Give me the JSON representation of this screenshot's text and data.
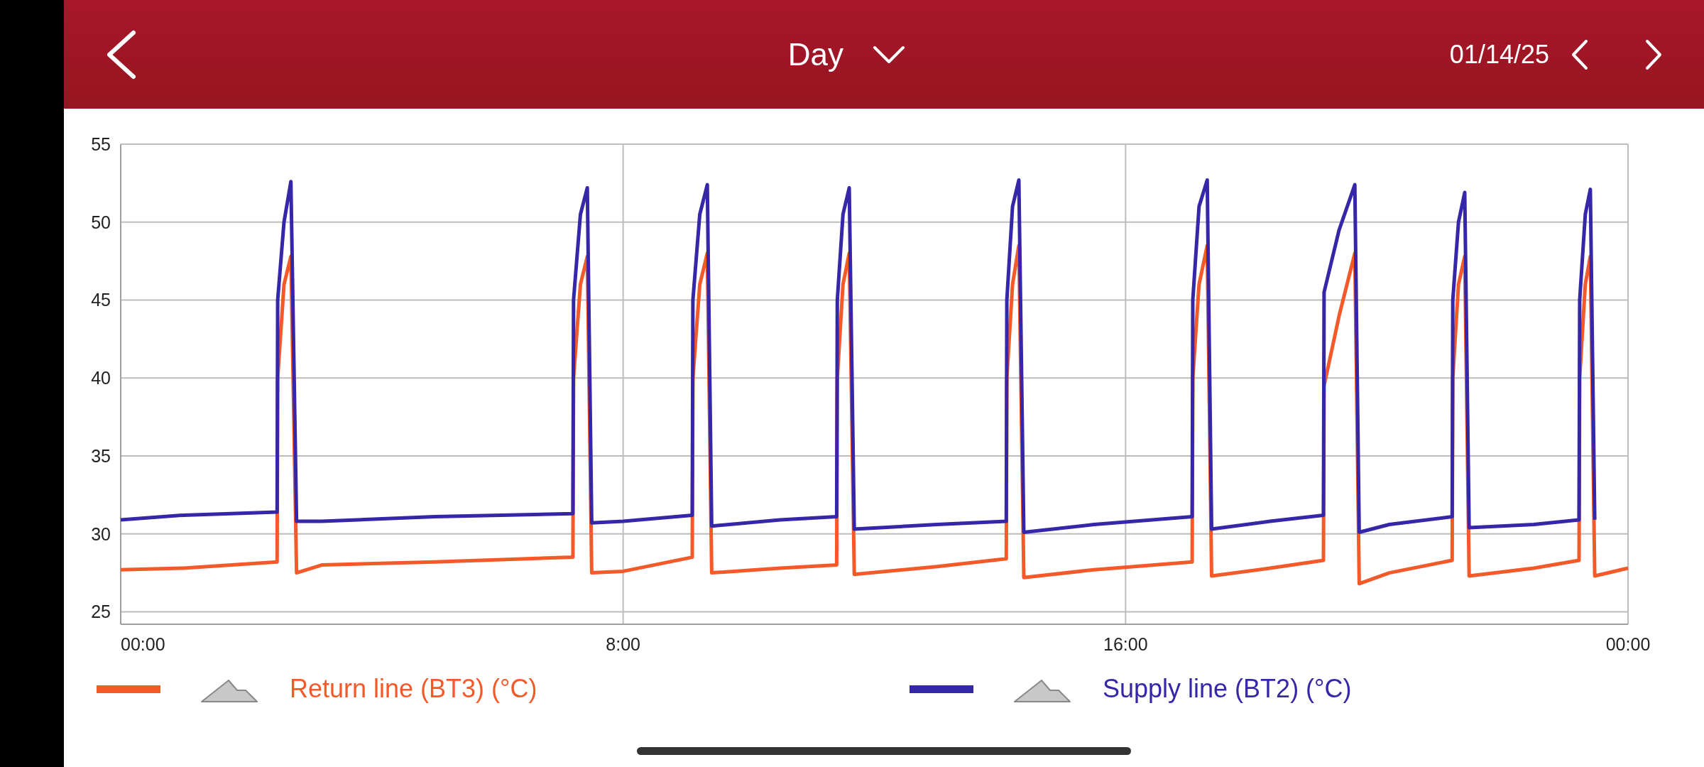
{
  "header": {
    "title": "Day",
    "date": "01/14/25"
  },
  "chart": {
    "chart_data": {
      "type": "line",
      "x": [
        0,
        1,
        2.49,
        2.5,
        2.6,
        2.71,
        2.8,
        3.2,
        5,
        7.2,
        7.21,
        7.32,
        7.43,
        7.5,
        8,
        9.1,
        9.11,
        9.22,
        9.34,
        9.41,
        10.5,
        11.4,
        11.41,
        11.5,
        11.6,
        11.68,
        13,
        14.1,
        14.11,
        14.2,
        14.3,
        14.38,
        15.5,
        17.06,
        17.07,
        17.17,
        17.3,
        17.37,
        18.3,
        19.15,
        19.16,
        19.4,
        19.65,
        19.72,
        20.2,
        21.2,
        21.21,
        21.3,
        21.4,
        21.47,
        22.5,
        23.22,
        23.23,
        23.32,
        23.4,
        23.47,
        24
      ],
      "series": [
        {
          "name": "Return line (BT3) (°C)",
          "color": "#f4592a",
          "values": [
            27.7,
            27.8,
            28.2,
            40,
            46,
            47.8,
            27.5,
            28.0,
            28.2,
            28.5,
            40,
            46,
            47.8,
            27.5,
            27.6,
            28.5,
            40,
            46,
            48,
            27.5,
            27.8,
            28.0,
            40,
            46,
            48,
            27.4,
            27.9,
            28.4,
            40,
            46,
            48.5,
            27.2,
            27.7,
            28.2,
            40,
            46,
            48.5,
            27.3,
            27.8,
            28.3,
            39.5,
            44,
            48,
            26.8,
            27.5,
            28.3,
            40,
            46,
            47.8,
            27.3,
            27.8,
            28.3,
            40,
            46,
            47.8,
            27.3,
            27.8
          ]
        },
        {
          "name": "Supply line (BT2) (°C)",
          "color": "#3527a8",
          "values": [
            30.9,
            31.2,
            31.4,
            45,
            50,
            52.6,
            30.8,
            30.8,
            31.1,
            31.3,
            45,
            50.5,
            52.2,
            30.7,
            30.8,
            31.2,
            45,
            50.5,
            52.4,
            30.5,
            30.9,
            31.1,
            45,
            50.5,
            52.2,
            30.3,
            30.6,
            30.8,
            45,
            51,
            52.7,
            30.1,
            30.6,
            31.1,
            45,
            51,
            52.7,
            30.3,
            30.8,
            31.2,
            45.5,
            49.5,
            52.4,
            30.1,
            30.6,
            31.1,
            45,
            50,
            51.9,
            30.4,
            30.6,
            30.9,
            45,
            50.5,
            52.1,
            30.9,
            null
          ]
        }
      ],
      "xlim": [
        0,
        24
      ],
      "ylim": [
        24.2,
        55
      ],
      "xticks": [
        {
          "value": 0,
          "label": "00:00"
        },
        {
          "value": 8,
          "label": "8:00"
        },
        {
          "value": 16,
          "label": "16:00"
        },
        {
          "value": 24,
          "label": "00:00"
        }
      ],
      "yticks": [
        25,
        30,
        35,
        40,
        45,
        50,
        55
      ],
      "grid": true
    }
  }
}
